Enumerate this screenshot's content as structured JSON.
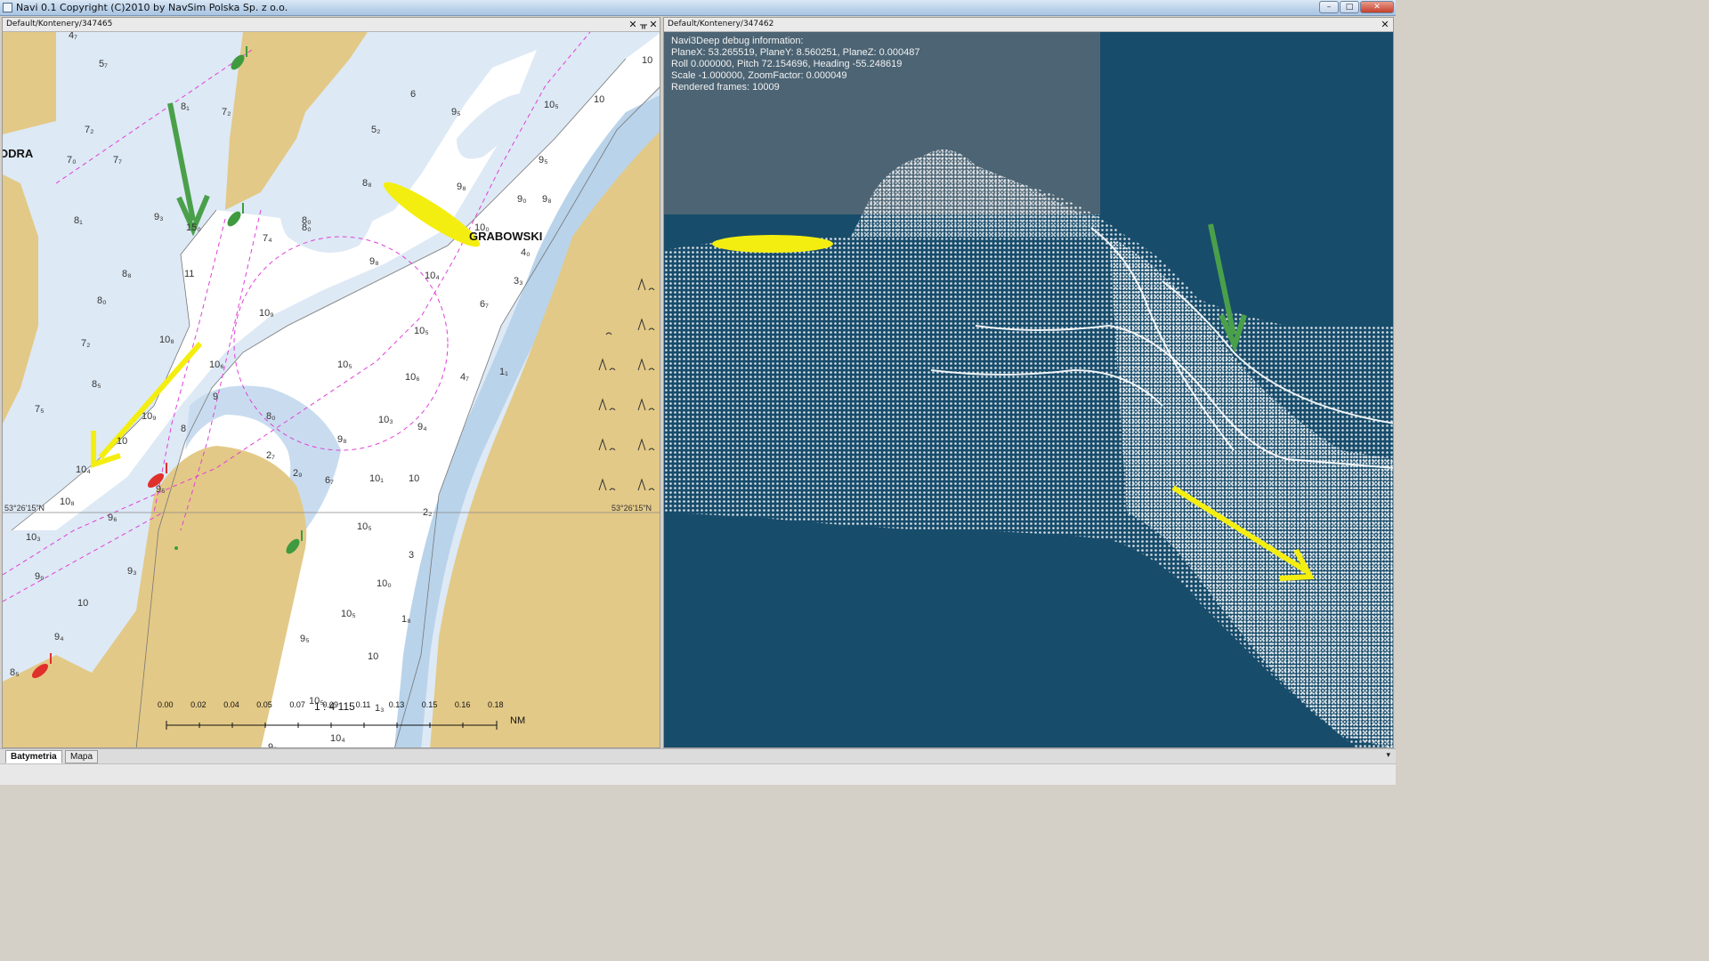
{
  "window": {
    "title": "Navi 0.1 Copyright (C)2010 by NavSim Polska Sp. z o.o.",
    "minimize": "–",
    "maximize": "□",
    "close": "✕"
  },
  "left_pane": {
    "title": "Default/Kontenery/347465",
    "close": "✕",
    "pin": "ᚂ",
    "close2": "✕",
    "place_names": [
      "ODRA",
      "GRABOWSKI"
    ],
    "coord_left": "53°26'15\"N",
    "coord_right": "53°26'15\"N",
    "scale_ratio": "1 : 4 115",
    "scale_ticks": [
      "0.00",
      "0.02",
      "0.04",
      "0.05",
      "0.07",
      "0.09",
      "0.11",
      "0.13",
      "0.15",
      "0.16",
      "0.18"
    ],
    "scale_unit": "NM",
    "depths": [
      {
        "t": "4₇"
      },
      {
        "t": "5₇"
      },
      {
        "t": "8₁"
      },
      {
        "t": "7₂"
      },
      {
        "t": "7₂"
      },
      {
        "t": "7₀"
      },
      {
        "t": "7₇"
      },
      {
        "t": "9₃"
      },
      {
        "t": "8₁"
      },
      {
        "t": "15₀"
      },
      {
        "t": "8₀"
      },
      {
        "t": "8₈"
      },
      {
        "t": "8₀"
      },
      {
        "t": "11"
      },
      {
        "t": "7₂"
      },
      {
        "t": "10₈"
      },
      {
        "t": "8₅"
      },
      {
        "t": "7₅"
      },
      {
        "t": "10₉"
      },
      {
        "t": "10₆"
      },
      {
        "t": "9"
      },
      {
        "t": "10"
      },
      {
        "t": "10₄"
      },
      {
        "t": "8"
      },
      {
        "t": "9₅"
      },
      {
        "t": "10₈"
      },
      {
        "t": "9₆"
      },
      {
        "t": "10₃"
      },
      {
        "t": "9₉"
      },
      {
        "t": "9₃"
      },
      {
        "t": "10"
      },
      {
        "t": "9₄"
      },
      {
        "t": "8₅"
      },
      {
        "t": "6"
      },
      {
        "t": "9₅"
      },
      {
        "t": "5₂"
      },
      {
        "t": "10₅"
      },
      {
        "t": "10"
      },
      {
        "t": "9₈"
      },
      {
        "t": "8₈"
      },
      {
        "t": "9₈"
      },
      {
        "t": "9₅"
      },
      {
        "t": "9₀"
      },
      {
        "t": "7₄"
      },
      {
        "t": "8₀"
      },
      {
        "t": "10₀"
      },
      {
        "t": "4₀"
      },
      {
        "t": "9₈"
      },
      {
        "t": "10₄"
      },
      {
        "t": "3₃"
      },
      {
        "t": "10₉"
      },
      {
        "t": "6₇"
      },
      {
        "t": "10₅"
      },
      {
        "t": "10₅"
      },
      {
        "t": "10₆"
      },
      {
        "t": "1₁"
      },
      {
        "t": "4₇"
      },
      {
        "t": "8₀"
      },
      {
        "t": "10₃"
      },
      {
        "t": "9₄"
      },
      {
        "t": "9₈"
      },
      {
        "t": "2₇"
      },
      {
        "t": "2₉"
      },
      {
        "t": "6₇"
      },
      {
        "t": "10₁"
      },
      {
        "t": "10"
      },
      {
        "t": "2₂"
      },
      {
        "t": "10₅"
      },
      {
        "t": "3"
      },
      {
        "t": "10₀"
      },
      {
        "t": "10₅"
      },
      {
        "t": "1₈"
      },
      {
        "t": "9₅"
      },
      {
        "t": "10"
      },
      {
        "t": "10₅"
      },
      {
        "t": "1₃"
      },
      {
        "t": "10₄"
      },
      {
        "t": "9₈"
      },
      {
        "t": "10"
      }
    ]
  },
  "right_pane": {
    "title": "Default/Kontenery/347462",
    "close": "✕",
    "debug_lines": [
      "Navi3Deep debug information:",
      "PlaneX: 53.265519, PlaneY: 8.560251, PlaneZ: 0.000487",
      "Roll 0.000000, Pitch 72.154696, Heading -55.248619",
      "Scale -1.000000, ZoomFactor: 0.000049",
      "Rendered frames: 10009"
    ]
  },
  "tabs": [
    "Batymetria",
    "Mapa"
  ],
  "colors": {
    "land": "#e3c987",
    "shallow_water": "#dde9f5",
    "deep_water": "#ffffff",
    "dredged_water": "#b9d3ea",
    "channel_line": "#e040d8",
    "arrow_green": "#4aa04a",
    "arrow_yellow": "#f4ee10",
    "buoy_red": "#e0302a",
    "buoy_green": "#3f9a3f",
    "scene_background": "#184c6b",
    "scene_points": "#ffffff"
  },
  "icons": [
    "app-icon",
    "pin-icon",
    "close-icon",
    "minimize-icon",
    "maximize-icon",
    "menu-arrow-icon"
  ]
}
